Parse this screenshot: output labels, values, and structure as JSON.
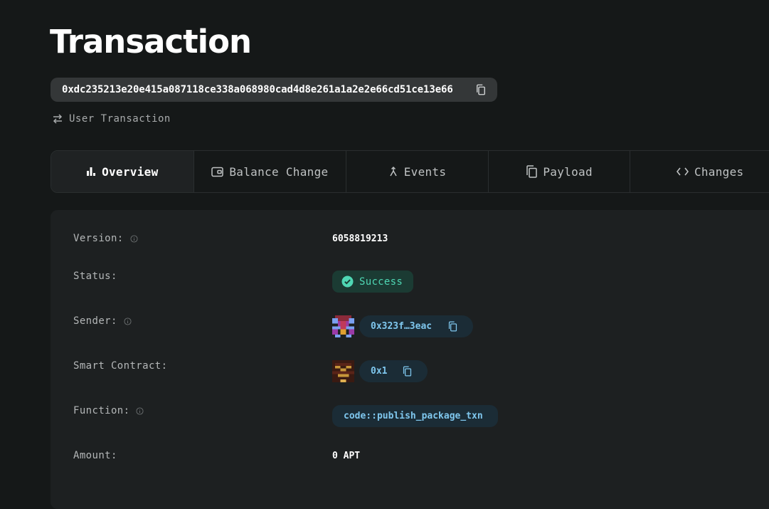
{
  "page": {
    "title": "Transaction"
  },
  "transaction": {
    "hash": "0xdc235213e20e415a087118ce338a068980cad4d8e261a1a2e2e66cd51ce13e66",
    "type_label": "User Transaction"
  },
  "tabs": [
    {
      "label": "Overview",
      "icon": "bar-chart-icon",
      "active": true
    },
    {
      "label": "Balance Change",
      "icon": "wallet-icon",
      "active": false
    },
    {
      "label": "Events",
      "icon": "merge-icon",
      "active": false
    },
    {
      "label": "Payload",
      "icon": "copy-pages-icon",
      "active": false
    },
    {
      "label": "Changes",
      "icon": "code-icon",
      "active": false
    }
  ],
  "details": {
    "version_label": "Version:",
    "version_value": "6058819213",
    "status_label": "Status:",
    "status_value": "Success",
    "sender_label": "Sender:",
    "sender_value": "0x323f…3eac",
    "contract_label": "Smart Contract:",
    "contract_value": "0x1",
    "function_label": "Function:",
    "function_value": "code::publish_package_txn",
    "amount_label": "Amount:",
    "amount_value": "0 APT"
  },
  "colors": {
    "background": "#151818",
    "panel": "#1d2021",
    "success_text": "#4fd7b4",
    "address_text": "#7fc7ee"
  }
}
